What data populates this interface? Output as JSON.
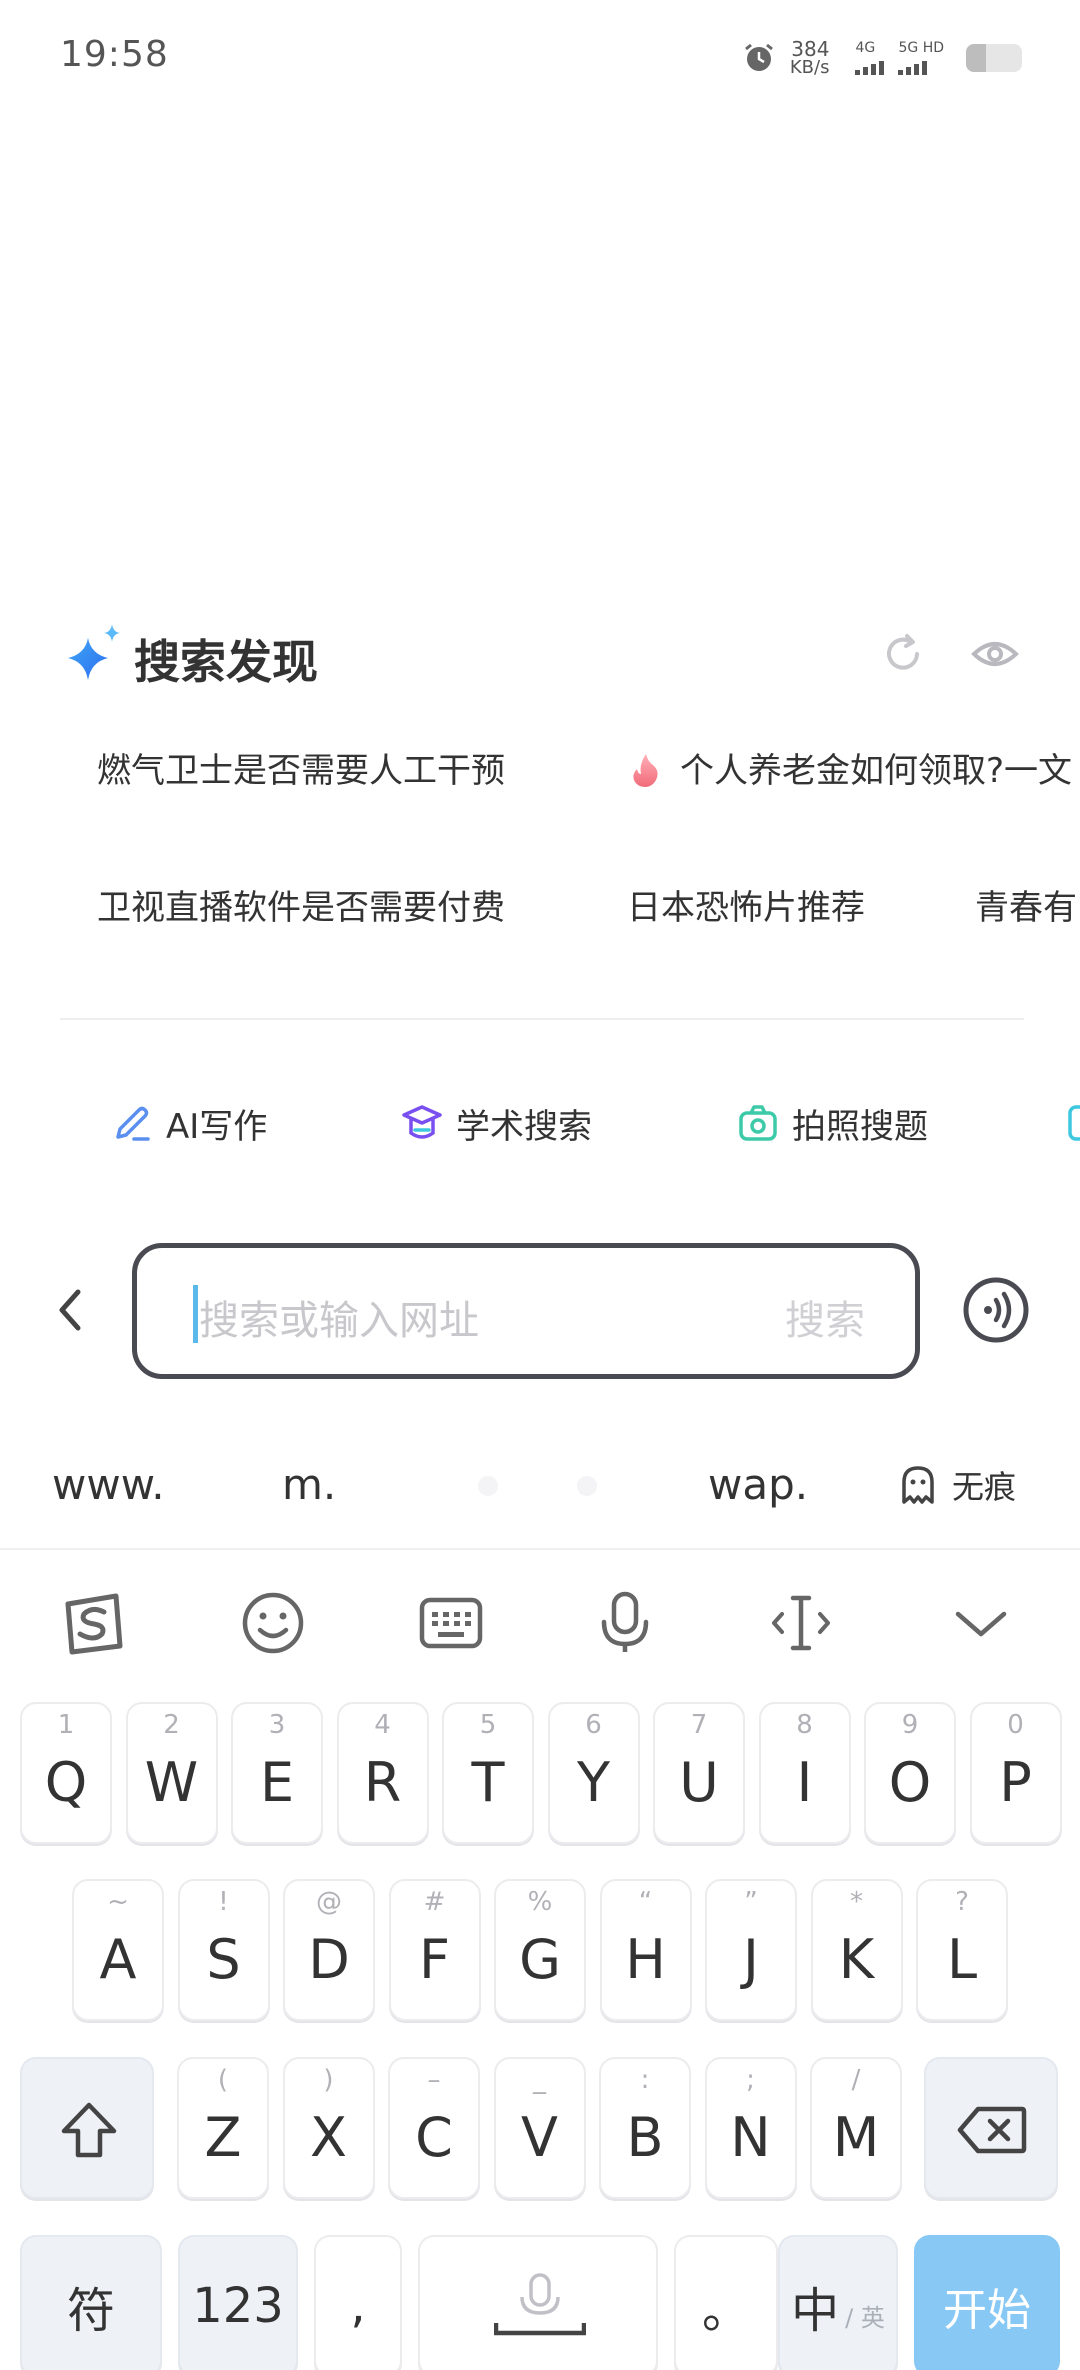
{
  "status_bar": {
    "time": "19:58",
    "net_speed_value": "384",
    "net_speed_unit": "KB/s",
    "signal1_label": "4G",
    "signal2_label": "5G HD",
    "battery_level": 0.35,
    "icons": [
      "alarm-icon",
      "signal-icon",
      "battery-icon"
    ]
  },
  "discover": {
    "title": "搜索发现",
    "icons": [
      "sparkle-icon",
      "refresh-icon",
      "eye-icon"
    ],
    "row1": [
      "燃气卫士是否需要人工干预",
      "个人养老金如何领取?一文"
    ],
    "row2": [
      "卫视直播软件是否需要付费",
      "日本恐怖片推荐",
      "青春有"
    ]
  },
  "tools": [
    {
      "label": "AI写作",
      "icon": "pencil-icon"
    },
    {
      "label": "学术搜索",
      "icon": "graduation-cap-icon"
    },
    {
      "label": "拍照搜题",
      "icon": "camera-icon"
    }
  ],
  "search": {
    "placeholder": "搜索或输入网址",
    "submit_label": "搜索"
  },
  "quick_inputs": {
    "www": "www.",
    "m": "m.",
    "wap": "wap.",
    "incognito": "无痕"
  },
  "keyboard": {
    "toolbar_icons": [
      "sogou-logo-icon",
      "emoji-icon",
      "keyboard-icon",
      "microphone-icon",
      "cursor-icon",
      "chevron-down-icon"
    ],
    "row1": [
      {
        "hint": "1",
        "key": "Q"
      },
      {
        "hint": "2",
        "key": "W"
      },
      {
        "hint": "3",
        "key": "E"
      },
      {
        "hint": "4",
        "key": "R"
      },
      {
        "hint": "5",
        "key": "T"
      },
      {
        "hint": "6",
        "key": "Y"
      },
      {
        "hint": "7",
        "key": "U"
      },
      {
        "hint": "8",
        "key": "I"
      },
      {
        "hint": "9",
        "key": "O"
      },
      {
        "hint": "0",
        "key": "P"
      }
    ],
    "row2": [
      {
        "hint": "~",
        "key": "A"
      },
      {
        "hint": "!",
        "key": "S"
      },
      {
        "hint": "@",
        "key": "D"
      },
      {
        "hint": "#",
        "key": "F"
      },
      {
        "hint": "%",
        "key": "G"
      },
      {
        "hint": "“",
        "key": "H"
      },
      {
        "hint": "”",
        "key": "J"
      },
      {
        "hint": "*",
        "key": "K"
      },
      {
        "hint": "?",
        "key": "L"
      }
    ],
    "row3": [
      {
        "hint": "(",
        "key": "Z"
      },
      {
        "hint": ")",
        "key": "X"
      },
      {
        "hint": "–",
        "key": "C"
      },
      {
        "hint": "_",
        "key": "V"
      },
      {
        "hint": ":",
        "key": "B"
      },
      {
        "hint": ";",
        "key": "N"
      },
      {
        "hint": "/",
        "key": "M"
      }
    ],
    "symbols_label": "符",
    "numbers_label": "123",
    "comma_label": ",",
    "period_label": "。",
    "lang_label": "中",
    "lang_sub_label": "/ 英",
    "enter_label": "开始",
    "accent_color": "#87c8f4"
  }
}
